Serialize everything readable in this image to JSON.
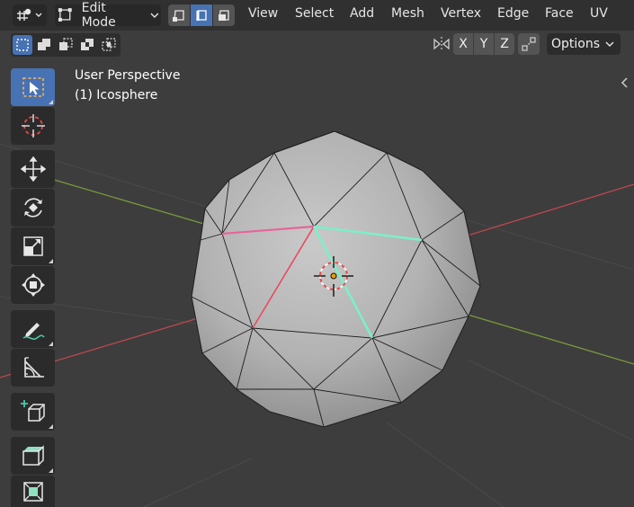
{
  "header": {
    "mode_label": "Edit Mode",
    "menus": [
      "View",
      "Select",
      "Add",
      "Mesh",
      "Vertex",
      "Edge",
      "Face",
      "UV"
    ]
  },
  "toolbar_row2": {
    "axis_labels": [
      "X",
      "Y",
      "Z"
    ],
    "options_label": "Options"
  },
  "viewport": {
    "view_name": "User Perspective",
    "object_name": "(1) Icosphere"
  },
  "colors": {
    "accent": "#4772b3",
    "header_bg": "#303030",
    "viewport_bg": "#3d3d3d",
    "x_axis": "#c0474e",
    "y_axis": "#7a9a3c",
    "selected_edge": "#7cf0c8",
    "seam_edge": "#e84a5f"
  },
  "icons": [
    "editor-type-icon",
    "select-box-icon",
    "cursor-icon",
    "move-icon",
    "rotate-icon",
    "scale-icon",
    "transform-icon",
    "annotate-icon",
    "measure-icon",
    "add-cube-icon",
    "extrude-icon",
    "inset-icon"
  ]
}
